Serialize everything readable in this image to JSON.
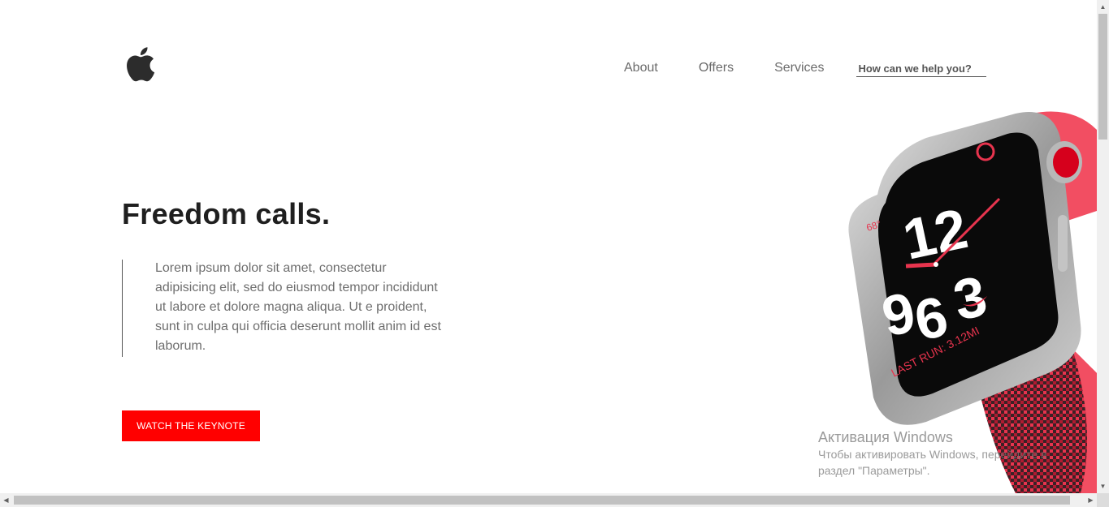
{
  "header": {
    "logo_icon": "apple-logo-icon",
    "nav": [
      {
        "label": "About"
      },
      {
        "label": "Offers"
      },
      {
        "label": "Services"
      }
    ],
    "search": {
      "placeholder": "How can we help you?",
      "value": ""
    }
  },
  "hero": {
    "title": "Freedom calls.",
    "body": "Lorem ipsum dolor sit amet, consectetur adipisicing elit, sed do eiusmod tempor incididunt ut labore et dolore magna aliqua. Ut e proident, sunt in culpa qui officia deserunt mollit anim id est laborum.",
    "cta_label": "WATCH THE KEYNOTE",
    "accent_color": "#ff0000"
  },
  "watch_face": {
    "temperature": "68°",
    "hours": [
      "12",
      "3",
      "9",
      "6"
    ],
    "last_run": "LAST RUN: 3.12MI"
  },
  "os_overlay": {
    "line1": "Активация Windows",
    "line2": "Чтобы активировать Windows, перейдите в",
    "line3": "раздел \"Параметры\"."
  },
  "scrollbars": {
    "up_icon": "arrow-up-icon",
    "down_icon": "arrow-down-icon",
    "left_icon": "arrow-left-icon",
    "right_icon": "arrow-right-icon"
  }
}
